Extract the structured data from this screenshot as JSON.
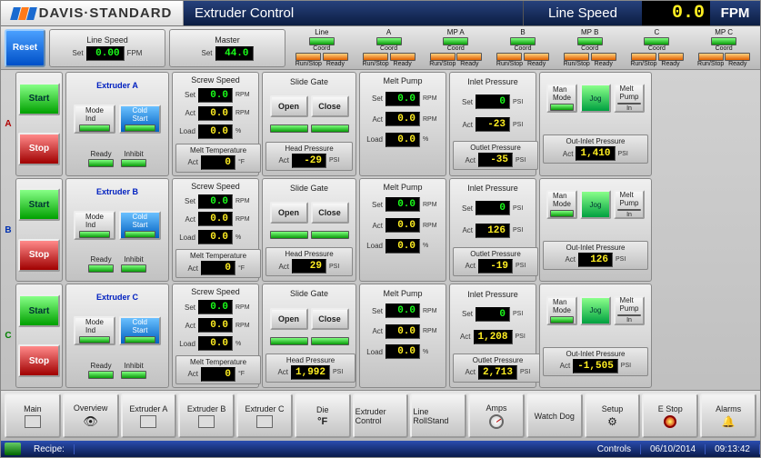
{
  "logo_text": "DAVIS·STANDARD",
  "title": "Extruder Control",
  "line_speed_label": "Line Speed",
  "line_speed_value": "0.0",
  "line_speed_unit": "FPM",
  "status": {
    "reset": "Reset",
    "line_speed": {
      "title": "Line Speed",
      "set_lbl": "Set",
      "value": "0.00",
      "unit": "FPM"
    },
    "master": {
      "title": "Master",
      "set_lbl": "Set",
      "value": "44.0"
    },
    "columns": [
      {
        "hdr": "Line",
        "left": {
          "lbl": "Run/Stop",
          "c": "o"
        },
        "right": {
          "lbl": "Ready",
          "c": "o"
        },
        "coord": true
      },
      {
        "hdr": "A",
        "left": {
          "lbl": "Run/Stop",
          "c": "o"
        },
        "right": {
          "lbl": "Ready",
          "c": "o"
        },
        "coord": true
      },
      {
        "hdr": "MP A",
        "left": {
          "lbl": "Run/Stop",
          "c": "o"
        },
        "right": {
          "lbl": "Ready",
          "c": "o"
        },
        "coord": true
      },
      {
        "hdr": "B",
        "left": {
          "lbl": "Run/Stop",
          "c": "o"
        },
        "right": {
          "lbl": "Ready",
          "c": "o"
        },
        "coord": true
      },
      {
        "hdr": "MP B",
        "left": {
          "lbl": "Run/Stop",
          "c": "o"
        },
        "right": {
          "lbl": "Ready",
          "c": "o"
        },
        "coord": true
      },
      {
        "hdr": "C",
        "left": {
          "lbl": "Run/Stop",
          "c": "o"
        },
        "right": {
          "lbl": "Ready",
          "c": "o"
        },
        "coord": true
      },
      {
        "hdr": "MP C",
        "left": {
          "lbl": "Run/Stop",
          "c": "o"
        },
        "right": {
          "lbl": "Ready",
          "c": "o"
        },
        "coord": true
      }
    ],
    "coord_lbl": "Coord"
  },
  "labels": {
    "start": "Start",
    "stop": "Stop",
    "mode": "Mode",
    "ind": "Ind",
    "cold": "Cold",
    "start2": "Start",
    "ready": "Ready",
    "inhibit": "Inhibit",
    "screw": "Screw Speed",
    "set": "Set",
    "act": "Act",
    "load": "Load",
    "rpm": "RPM",
    "pct": "%",
    "slide": "Slide Gate",
    "open": "Open",
    "close": "Close",
    "head": "Head Pressure",
    "psi": "PSI",
    "melt": "Melt Pump",
    "melt_t": "Melt Temperature",
    "degF": "°F",
    "inlet": "Inlet Pressure",
    "outlet": "Outlet Pressure",
    "outin": "Out-Inlet Pressure",
    "man": "Man",
    "jog": "Jog",
    "mpump": "Melt",
    "pump2": "Pump",
    "in": "In"
  },
  "extruders": [
    {
      "id": "A",
      "name": "Extruder A",
      "letter_cls": "a",
      "screw": {
        "set": "0.0",
        "act": "0.0",
        "load": "0.0"
      },
      "melt_t": "0",
      "head": "-29",
      "melt": {
        "set": "0.0",
        "act": "0.0",
        "load": "0.0"
      },
      "inlet": {
        "set": "0",
        "act": "-23"
      },
      "outlet": "-35",
      "outin": "1,410"
    },
    {
      "id": "B",
      "name": "Extruder B",
      "letter_cls": "b",
      "screw": {
        "set": "0.0",
        "act": "0.0",
        "load": "0.0"
      },
      "melt_t": "0",
      "head": "29",
      "melt": {
        "set": "0.0",
        "act": "0.0",
        "load": "0.0"
      },
      "inlet": {
        "set": "0",
        "act": "126"
      },
      "outlet": "-19",
      "outin": "126"
    },
    {
      "id": "C",
      "name": "Extruder C",
      "letter_cls": "c",
      "screw": {
        "set": "0.0",
        "act": "0.0",
        "load": "0.0"
      },
      "melt_t": "0",
      "head": "1,992",
      "melt": {
        "set": "0.0",
        "act": "0.0",
        "load": "0.0"
      },
      "inlet": {
        "set": "0",
        "act": "1,208"
      },
      "outlet": "2,713",
      "outin": "-1,505"
    }
  ],
  "nav": [
    {
      "lbl": "Main",
      "ico": "screen"
    },
    {
      "lbl": "Overview",
      "ico": "eye"
    },
    {
      "lbl": "Extruder A",
      "ico": "ext"
    },
    {
      "lbl": "Extruder B",
      "ico": "ext"
    },
    {
      "lbl": "Extruder C",
      "ico": "ext"
    },
    {
      "lbl": "Die",
      "ico": "degF"
    },
    {
      "lbl": "Extruder Control",
      "ico": ""
    },
    {
      "lbl": "Line RollStand",
      "ico": ""
    },
    {
      "lbl": "Amps",
      "ico": "amp"
    },
    {
      "lbl": "Watch Dog",
      "ico": ""
    },
    {
      "lbl": "Setup",
      "ico": "gear"
    },
    {
      "lbl": "E Stop",
      "ico": "estop"
    },
    {
      "lbl": "Alarms",
      "ico": "bell"
    }
  ],
  "taskbar": {
    "recipe": "Recipe:",
    "controls": "Controls",
    "date": "06/10/2014",
    "time": "09:13:42"
  }
}
